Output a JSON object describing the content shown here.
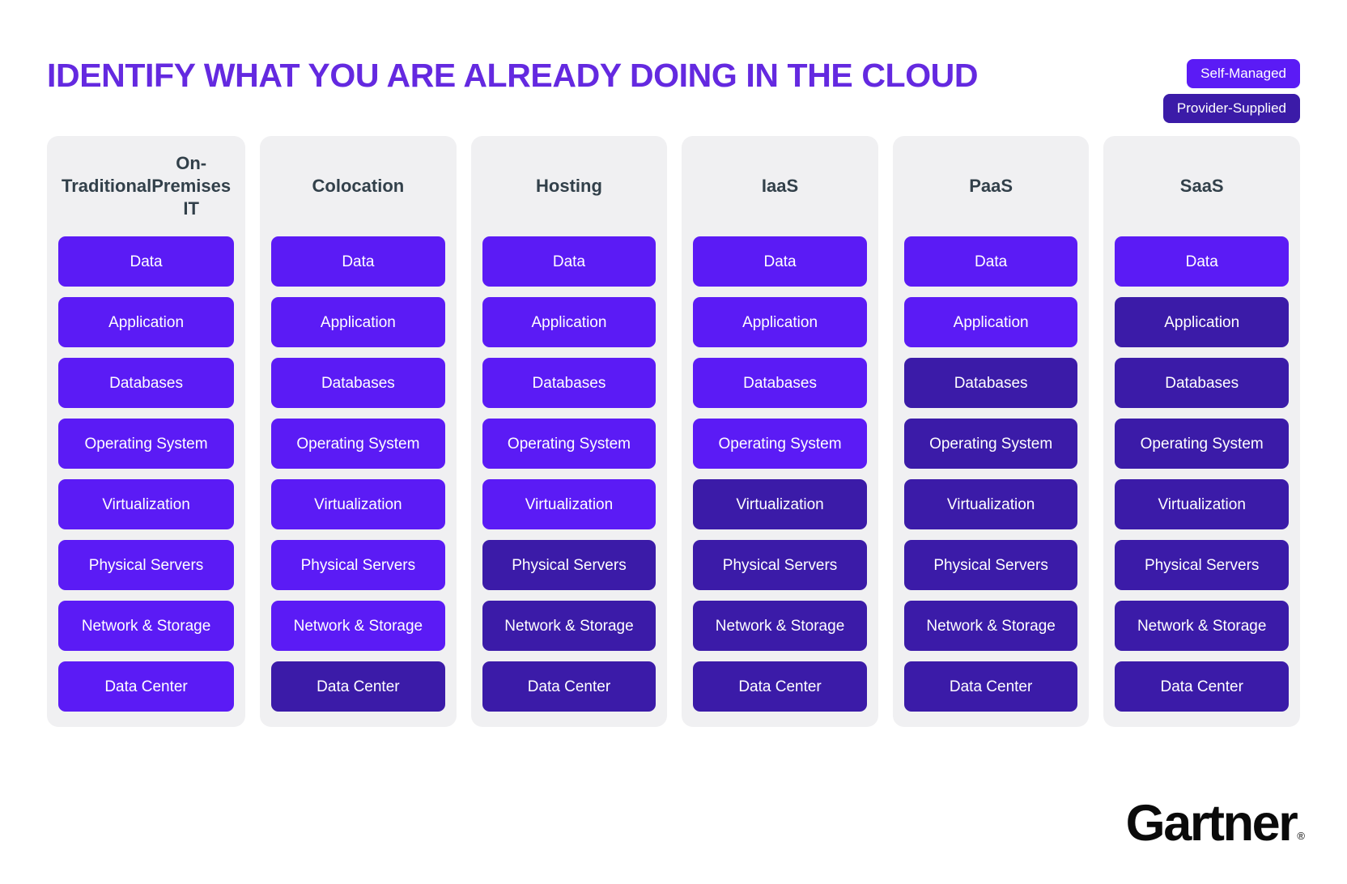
{
  "header": {
    "title": "IDENTIFY WHAT YOU ARE ALREADY DOING IN THE CLOUD",
    "title_color": "#6429E0"
  },
  "legend": {
    "items": [
      {
        "label": "Self-Managed",
        "color": "#5B1BF5",
        "key": "self"
      },
      {
        "label": "Provider-Supplied",
        "color": "#3B1BA8",
        "key": "prov"
      }
    ]
  },
  "colors": {
    "self_managed": "#5B1BF5",
    "provider_supplied": "#3B1BA8",
    "card_background": "#F0F0F2",
    "header_text": "#32404A",
    "page_background": "#FFFFFF"
  },
  "layers": [
    "Data",
    "Application",
    "Databases",
    "Operating System",
    "Virtualization",
    "Physical Servers",
    "Network & Storage",
    "Data Center"
  ],
  "columns": [
    {
      "title": "Traditional\nOn-Premises IT",
      "title_line1": "Traditional",
      "title_line2": "On-Premises IT",
      "cells": [
        {
          "label": "Data",
          "owner": "self"
        },
        {
          "label": "Application",
          "owner": "self"
        },
        {
          "label": "Databases",
          "owner": "self"
        },
        {
          "label": "Operating System",
          "owner": "self"
        },
        {
          "label": "Virtualization",
          "owner": "self"
        },
        {
          "label": "Physical Servers",
          "owner": "self"
        },
        {
          "label": "Network & Storage",
          "owner": "self"
        },
        {
          "label": "Data Center",
          "owner": "self"
        }
      ]
    },
    {
      "title": "Colocation",
      "title_line1": "Colocation",
      "title_line2": "",
      "cells": [
        {
          "label": "Data",
          "owner": "self"
        },
        {
          "label": "Application",
          "owner": "self"
        },
        {
          "label": "Databases",
          "owner": "self"
        },
        {
          "label": "Operating System",
          "owner": "self"
        },
        {
          "label": "Virtualization",
          "owner": "self"
        },
        {
          "label": "Physical Servers",
          "owner": "self"
        },
        {
          "label": "Network & Storage",
          "owner": "self"
        },
        {
          "label": "Data Center",
          "owner": "prov"
        }
      ]
    },
    {
      "title": "Hosting",
      "title_line1": "Hosting",
      "title_line2": "",
      "cells": [
        {
          "label": "Data",
          "owner": "self"
        },
        {
          "label": "Application",
          "owner": "self"
        },
        {
          "label": "Databases",
          "owner": "self"
        },
        {
          "label": "Operating System",
          "owner": "self"
        },
        {
          "label": "Virtualization",
          "owner": "self"
        },
        {
          "label": "Physical Servers",
          "owner": "prov"
        },
        {
          "label": "Network & Storage",
          "owner": "prov"
        },
        {
          "label": "Data Center",
          "owner": "prov"
        }
      ]
    },
    {
      "title": "IaaS",
      "title_line1": "IaaS",
      "title_line2": "",
      "cells": [
        {
          "label": "Data",
          "owner": "self"
        },
        {
          "label": "Application",
          "owner": "self"
        },
        {
          "label": "Databases",
          "owner": "self"
        },
        {
          "label": "Operating System",
          "owner": "self"
        },
        {
          "label": "Virtualization",
          "owner": "prov"
        },
        {
          "label": "Physical Servers",
          "owner": "prov"
        },
        {
          "label": "Network & Storage",
          "owner": "prov"
        },
        {
          "label": "Data Center",
          "owner": "prov"
        }
      ]
    },
    {
      "title": "PaaS",
      "title_line1": "PaaS",
      "title_line2": "",
      "cells": [
        {
          "label": "Data",
          "owner": "self"
        },
        {
          "label": "Application",
          "owner": "self"
        },
        {
          "label": "Databases",
          "owner": "prov"
        },
        {
          "label": "Operating System",
          "owner": "prov"
        },
        {
          "label": "Virtualization",
          "owner": "prov"
        },
        {
          "label": "Physical Servers",
          "owner": "prov"
        },
        {
          "label": "Network & Storage",
          "owner": "prov"
        },
        {
          "label": "Data Center",
          "owner": "prov"
        }
      ]
    },
    {
      "title": "SaaS",
      "title_line1": "SaaS",
      "title_line2": "",
      "cells": [
        {
          "label": "Data",
          "owner": "self"
        },
        {
          "label": "Application",
          "owner": "prov"
        },
        {
          "label": "Databases",
          "owner": "prov"
        },
        {
          "label": "Operating System",
          "owner": "prov"
        },
        {
          "label": "Virtualization",
          "owner": "prov"
        },
        {
          "label": "Physical Servers",
          "owner": "prov"
        },
        {
          "label": "Network & Storage",
          "owner": "prov"
        },
        {
          "label": "Data Center",
          "owner": "prov"
        }
      ]
    }
  ],
  "footer": {
    "logo_text": "Gartner",
    "logo_registered": "®"
  }
}
